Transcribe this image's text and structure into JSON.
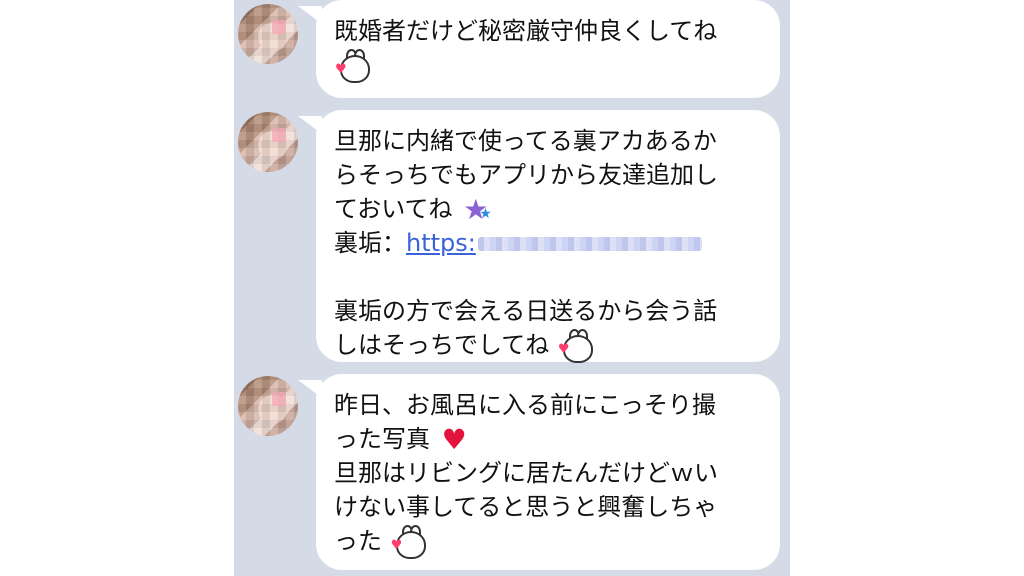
{
  "messages": [
    {
      "lines": [
        "既婚者だけど秘密厳守仲良くしてね"
      ],
      "emoji": "bunny-kiss-icon"
    },
    {
      "lines": [
        "旦那に内緒で使ってる裏アカあるか",
        "らそっちでもアプリから友達追加し",
        "ておいてね"
      ],
      "star_icon": "star-icon",
      "link_label": "裏垢：",
      "link_text": "https:",
      "after_lines": [
        "裏垢の方で会える日送るから会う話",
        "しはそっちでしてね"
      ],
      "emoji": "bunny-kiss-icon"
    },
    {
      "lines": [
        "昨日、お風呂に入る前にこっそり撮",
        "った写真"
      ],
      "heart_icon": "heart-icon",
      "after_lines": [
        "旦那はリビングに居たんだけどｗい",
        "けない事してると思うと興奮しちゃ",
        "った"
      ],
      "emoji": "bunny-kiss-icon"
    }
  ],
  "colors": {
    "background": "#d4dae6",
    "bubble": "#ffffff",
    "link": "#3b63d9"
  }
}
